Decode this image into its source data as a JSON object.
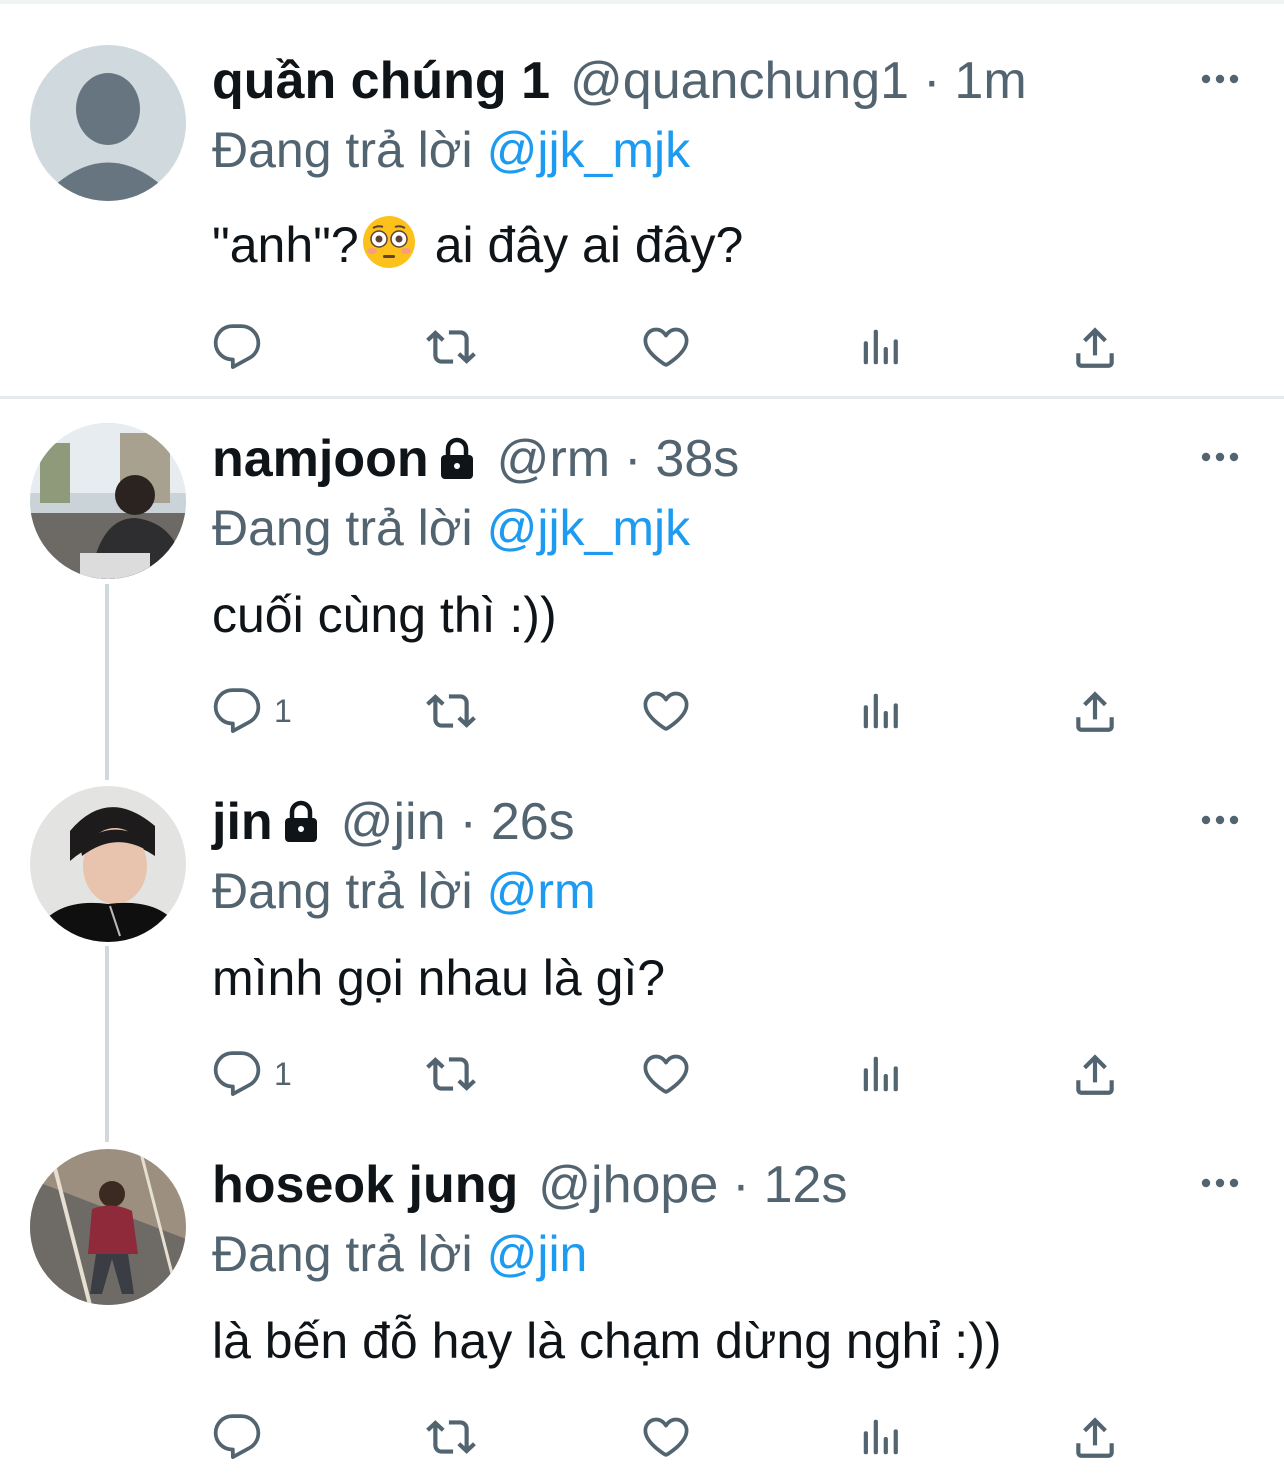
{
  "reply_prefix": "Đang trả lời",
  "tweets": [
    {
      "name": "quần chúng 1",
      "handle": "@quanchung1",
      "separator": "·",
      "time": "1m",
      "reply_to": "@jjk_mjk",
      "text_before_emoji": "\"anh\"?",
      "emoji": "flushed-face",
      "text_after_emoji": "ai đây ai đây?",
      "reply_count": "",
      "locked": false
    },
    {
      "name": "namjoon",
      "handle": "@rm",
      "separator": "·",
      "time": "38s",
      "reply_to": "@jjk_mjk",
      "text": "cuối cùng thì :))",
      "reply_count": "1",
      "locked": true
    },
    {
      "name": "jin",
      "handle": "@jin",
      "separator": "·",
      "time": "26s",
      "reply_to": "@rm",
      "text": "mình gọi nhau là gì?",
      "reply_count": "1",
      "locked": true
    },
    {
      "name": "hoseok jung",
      "handle": "@jhope",
      "separator": "·",
      "time": "12s",
      "reply_to": "@jin",
      "text": "là bến đỗ hay là chạm dừng nghỉ :))",
      "reply_count": "",
      "locked": false
    }
  ],
  "colors": {
    "text": "#0f1419",
    "secondary": "#536471",
    "link": "#1d9bf0",
    "thread_line": "#cfd9de"
  },
  "icons": [
    "reply-icon",
    "retweet-icon",
    "like-icon",
    "views-icon",
    "share-icon",
    "more-icon",
    "lock-icon"
  ]
}
